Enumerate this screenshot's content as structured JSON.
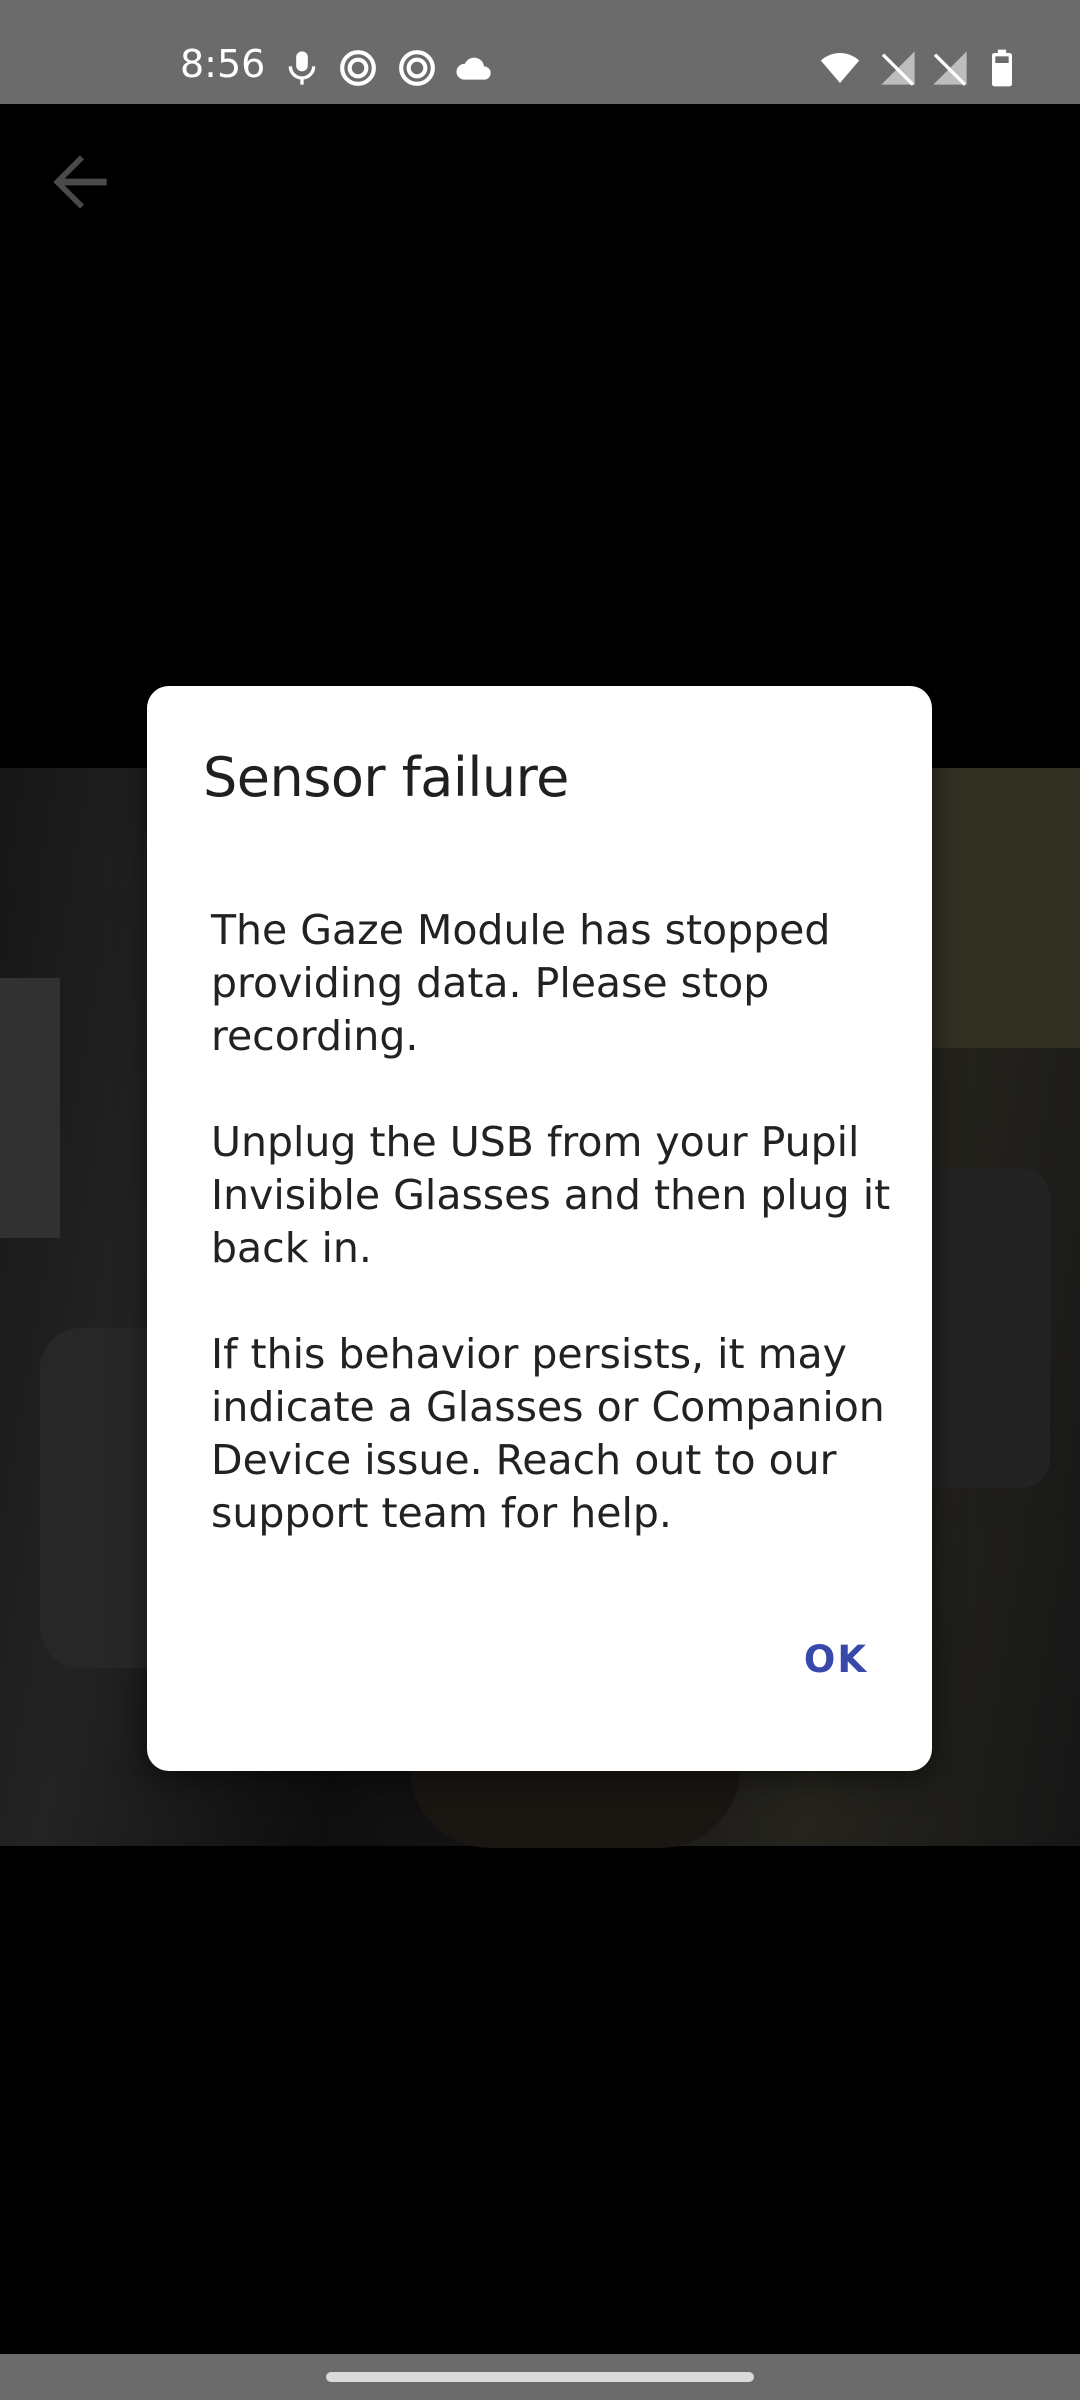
{
  "status_bar": {
    "time": "8:56",
    "icons": [
      "mic-icon",
      "ring-icon",
      "ring-icon",
      "cloud-icon",
      "wifi-icon",
      "no-signal-icon",
      "no-signal-icon",
      "battery-icon"
    ]
  },
  "dialog": {
    "title": "Sensor failure",
    "paragraphs": [
      "The Gaze Module has stopped providing data. Please stop recording.",
      "Unplug the USB from your Pupil Invisible Glasses and then plug it back in.",
      "If this behavior persists, it may indicate a Glasses or Companion Device issue. Reach out to our support team for help."
    ],
    "ok_label": "OK"
  },
  "colors": {
    "accent": "#3949ab",
    "status_bar": "#6b6b6b",
    "background": "#000000"
  }
}
